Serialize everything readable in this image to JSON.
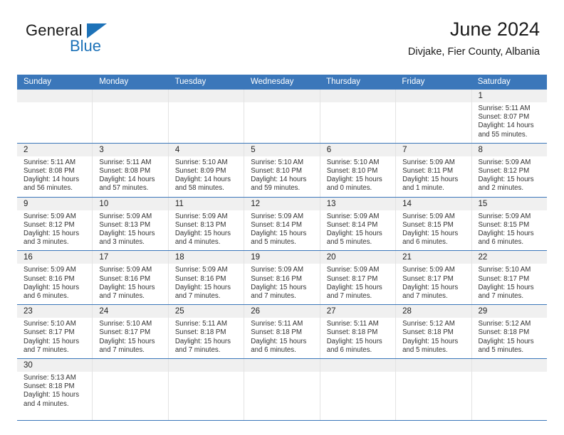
{
  "brand": {
    "name_part1": "General",
    "name_part2": "Blue",
    "accent_color": "#1d72b8"
  },
  "header": {
    "title": "June 2024",
    "subtitle": "Divjake, Fier County, Albania"
  },
  "calendar": {
    "header_color": "#3b77ba",
    "weekdays": [
      "Sunday",
      "Monday",
      "Tuesday",
      "Wednesday",
      "Thursday",
      "Friday",
      "Saturday"
    ],
    "weeks": [
      [
        {
          "date": "",
          "sunrise": "",
          "sunset": "",
          "daylight": "",
          "daylight2": ""
        },
        {
          "date": "",
          "sunrise": "",
          "sunset": "",
          "daylight": "",
          "daylight2": ""
        },
        {
          "date": "",
          "sunrise": "",
          "sunset": "",
          "daylight": "",
          "daylight2": ""
        },
        {
          "date": "",
          "sunrise": "",
          "sunset": "",
          "daylight": "",
          "daylight2": ""
        },
        {
          "date": "",
          "sunrise": "",
          "sunset": "",
          "daylight": "",
          "daylight2": ""
        },
        {
          "date": "",
          "sunrise": "",
          "sunset": "",
          "daylight": "",
          "daylight2": ""
        },
        {
          "date": "1",
          "sunrise": "Sunrise: 5:11 AM",
          "sunset": "Sunset: 8:07 PM",
          "daylight": "Daylight: 14 hours",
          "daylight2": "and 55 minutes."
        }
      ],
      [
        {
          "date": "2",
          "sunrise": "Sunrise: 5:11 AM",
          "sunset": "Sunset: 8:08 PM",
          "daylight": "Daylight: 14 hours",
          "daylight2": "and 56 minutes."
        },
        {
          "date": "3",
          "sunrise": "Sunrise: 5:11 AM",
          "sunset": "Sunset: 8:08 PM",
          "daylight": "Daylight: 14 hours",
          "daylight2": "and 57 minutes."
        },
        {
          "date": "4",
          "sunrise": "Sunrise: 5:10 AM",
          "sunset": "Sunset: 8:09 PM",
          "daylight": "Daylight: 14 hours",
          "daylight2": "and 58 minutes."
        },
        {
          "date": "5",
          "sunrise": "Sunrise: 5:10 AM",
          "sunset": "Sunset: 8:10 PM",
          "daylight": "Daylight: 14 hours",
          "daylight2": "and 59 minutes."
        },
        {
          "date": "6",
          "sunrise": "Sunrise: 5:10 AM",
          "sunset": "Sunset: 8:10 PM",
          "daylight": "Daylight: 15 hours",
          "daylight2": "and 0 minutes."
        },
        {
          "date": "7",
          "sunrise": "Sunrise: 5:09 AM",
          "sunset": "Sunset: 8:11 PM",
          "daylight": "Daylight: 15 hours",
          "daylight2": "and 1 minute."
        },
        {
          "date": "8",
          "sunrise": "Sunrise: 5:09 AM",
          "sunset": "Sunset: 8:12 PM",
          "daylight": "Daylight: 15 hours",
          "daylight2": "and 2 minutes."
        }
      ],
      [
        {
          "date": "9",
          "sunrise": "Sunrise: 5:09 AM",
          "sunset": "Sunset: 8:12 PM",
          "daylight": "Daylight: 15 hours",
          "daylight2": "and 3 minutes."
        },
        {
          "date": "10",
          "sunrise": "Sunrise: 5:09 AM",
          "sunset": "Sunset: 8:13 PM",
          "daylight": "Daylight: 15 hours",
          "daylight2": "and 3 minutes."
        },
        {
          "date": "11",
          "sunrise": "Sunrise: 5:09 AM",
          "sunset": "Sunset: 8:13 PM",
          "daylight": "Daylight: 15 hours",
          "daylight2": "and 4 minutes."
        },
        {
          "date": "12",
          "sunrise": "Sunrise: 5:09 AM",
          "sunset": "Sunset: 8:14 PM",
          "daylight": "Daylight: 15 hours",
          "daylight2": "and 5 minutes."
        },
        {
          "date": "13",
          "sunrise": "Sunrise: 5:09 AM",
          "sunset": "Sunset: 8:14 PM",
          "daylight": "Daylight: 15 hours",
          "daylight2": "and 5 minutes."
        },
        {
          "date": "14",
          "sunrise": "Sunrise: 5:09 AM",
          "sunset": "Sunset: 8:15 PM",
          "daylight": "Daylight: 15 hours",
          "daylight2": "and 6 minutes."
        },
        {
          "date": "15",
          "sunrise": "Sunrise: 5:09 AM",
          "sunset": "Sunset: 8:15 PM",
          "daylight": "Daylight: 15 hours",
          "daylight2": "and 6 minutes."
        }
      ],
      [
        {
          "date": "16",
          "sunrise": "Sunrise: 5:09 AM",
          "sunset": "Sunset: 8:16 PM",
          "daylight": "Daylight: 15 hours",
          "daylight2": "and 6 minutes."
        },
        {
          "date": "17",
          "sunrise": "Sunrise: 5:09 AM",
          "sunset": "Sunset: 8:16 PM",
          "daylight": "Daylight: 15 hours",
          "daylight2": "and 7 minutes."
        },
        {
          "date": "18",
          "sunrise": "Sunrise: 5:09 AM",
          "sunset": "Sunset: 8:16 PM",
          "daylight": "Daylight: 15 hours",
          "daylight2": "and 7 minutes."
        },
        {
          "date": "19",
          "sunrise": "Sunrise: 5:09 AM",
          "sunset": "Sunset: 8:16 PM",
          "daylight": "Daylight: 15 hours",
          "daylight2": "and 7 minutes."
        },
        {
          "date": "20",
          "sunrise": "Sunrise: 5:09 AM",
          "sunset": "Sunset: 8:17 PM",
          "daylight": "Daylight: 15 hours",
          "daylight2": "and 7 minutes."
        },
        {
          "date": "21",
          "sunrise": "Sunrise: 5:09 AM",
          "sunset": "Sunset: 8:17 PM",
          "daylight": "Daylight: 15 hours",
          "daylight2": "and 7 minutes."
        },
        {
          "date": "22",
          "sunrise": "Sunrise: 5:10 AM",
          "sunset": "Sunset: 8:17 PM",
          "daylight": "Daylight: 15 hours",
          "daylight2": "and 7 minutes."
        }
      ],
      [
        {
          "date": "23",
          "sunrise": "Sunrise: 5:10 AM",
          "sunset": "Sunset: 8:17 PM",
          "daylight": "Daylight: 15 hours",
          "daylight2": "and 7 minutes."
        },
        {
          "date": "24",
          "sunrise": "Sunrise: 5:10 AM",
          "sunset": "Sunset: 8:17 PM",
          "daylight": "Daylight: 15 hours",
          "daylight2": "and 7 minutes."
        },
        {
          "date": "25",
          "sunrise": "Sunrise: 5:11 AM",
          "sunset": "Sunset: 8:18 PM",
          "daylight": "Daylight: 15 hours",
          "daylight2": "and 7 minutes."
        },
        {
          "date": "26",
          "sunrise": "Sunrise: 5:11 AM",
          "sunset": "Sunset: 8:18 PM",
          "daylight": "Daylight: 15 hours",
          "daylight2": "and 6 minutes."
        },
        {
          "date": "27",
          "sunrise": "Sunrise: 5:11 AM",
          "sunset": "Sunset: 8:18 PM",
          "daylight": "Daylight: 15 hours",
          "daylight2": "and 6 minutes."
        },
        {
          "date": "28",
          "sunrise": "Sunrise: 5:12 AM",
          "sunset": "Sunset: 8:18 PM",
          "daylight": "Daylight: 15 hours",
          "daylight2": "and 5 minutes."
        },
        {
          "date": "29",
          "sunrise": "Sunrise: 5:12 AM",
          "sunset": "Sunset: 8:18 PM",
          "daylight": "Daylight: 15 hours",
          "daylight2": "and 5 minutes."
        }
      ],
      [
        {
          "date": "30",
          "sunrise": "Sunrise: 5:13 AM",
          "sunset": "Sunset: 8:18 PM",
          "daylight": "Daylight: 15 hours",
          "daylight2": "and 4 minutes."
        },
        {
          "date": "",
          "sunrise": "",
          "sunset": "",
          "daylight": "",
          "daylight2": ""
        },
        {
          "date": "",
          "sunrise": "",
          "sunset": "",
          "daylight": "",
          "daylight2": ""
        },
        {
          "date": "",
          "sunrise": "",
          "sunset": "",
          "daylight": "",
          "daylight2": ""
        },
        {
          "date": "",
          "sunrise": "",
          "sunset": "",
          "daylight": "",
          "daylight2": ""
        },
        {
          "date": "",
          "sunrise": "",
          "sunset": "",
          "daylight": "",
          "daylight2": ""
        },
        {
          "date": "",
          "sunrise": "",
          "sunset": "",
          "daylight": "",
          "daylight2": ""
        }
      ]
    ]
  }
}
